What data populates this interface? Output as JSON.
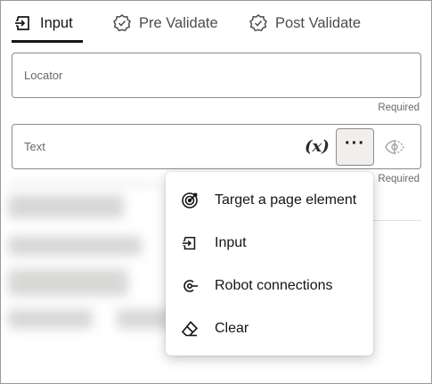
{
  "tabs": [
    {
      "label": "Input",
      "icon": "input-icon",
      "active": true
    },
    {
      "label": "Pre Validate",
      "icon": "check-badge-icon",
      "active": false
    },
    {
      "label": "Post Validate",
      "icon": "check-badge-icon",
      "active": false
    }
  ],
  "fields": {
    "locator": {
      "label": "Locator",
      "required_text": "Required"
    },
    "text": {
      "label": "Text",
      "required_text": "Required",
      "variable_button": "(x)"
    }
  },
  "menu": {
    "items": [
      {
        "label": "Target a page element",
        "icon": "target-icon"
      },
      {
        "label": "Input",
        "icon": "input-icon"
      },
      {
        "label": "Robot connections",
        "icon": "robot-connection-icon"
      },
      {
        "label": "Clear",
        "icon": "eraser-icon"
      }
    ]
  },
  "colors": {
    "text_primary": "#161513",
    "text_secondary": "#6b6865",
    "border": "#8d8a86",
    "button_bg": "#f1efed"
  }
}
